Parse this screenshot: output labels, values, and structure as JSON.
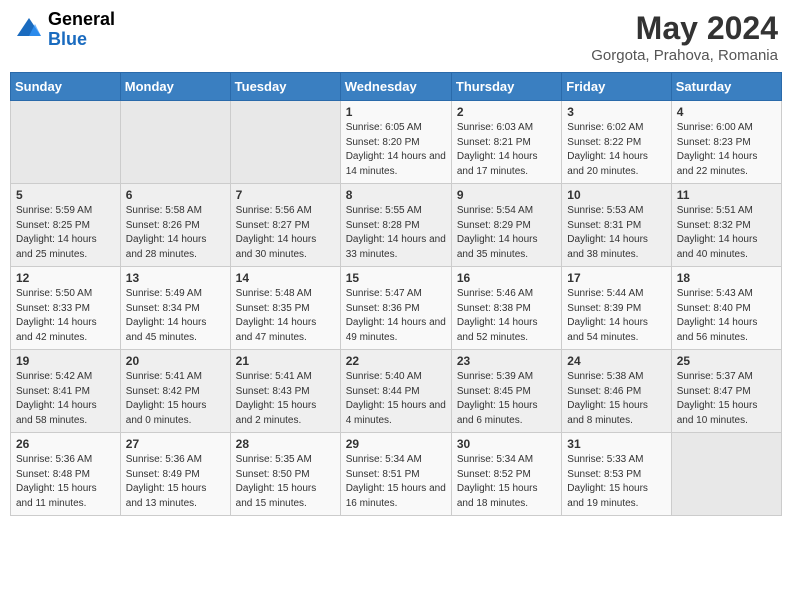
{
  "header": {
    "logo": {
      "general": "General",
      "blue": "Blue"
    },
    "month": "May 2024",
    "location": "Gorgota, Prahova, Romania"
  },
  "days_of_week": [
    "Sunday",
    "Monday",
    "Tuesday",
    "Wednesday",
    "Thursday",
    "Friday",
    "Saturday"
  ],
  "weeks": [
    [
      {
        "day": "",
        "info": ""
      },
      {
        "day": "",
        "info": ""
      },
      {
        "day": "",
        "info": ""
      },
      {
        "day": "1",
        "info": "Sunrise: 6:05 AM\nSunset: 8:20 PM\nDaylight: 14 hours and 14 minutes."
      },
      {
        "day": "2",
        "info": "Sunrise: 6:03 AM\nSunset: 8:21 PM\nDaylight: 14 hours and 17 minutes."
      },
      {
        "day": "3",
        "info": "Sunrise: 6:02 AM\nSunset: 8:22 PM\nDaylight: 14 hours and 20 minutes."
      },
      {
        "day": "4",
        "info": "Sunrise: 6:00 AM\nSunset: 8:23 PM\nDaylight: 14 hours and 22 minutes."
      }
    ],
    [
      {
        "day": "5",
        "info": "Sunrise: 5:59 AM\nSunset: 8:25 PM\nDaylight: 14 hours and 25 minutes."
      },
      {
        "day": "6",
        "info": "Sunrise: 5:58 AM\nSunset: 8:26 PM\nDaylight: 14 hours and 28 minutes."
      },
      {
        "day": "7",
        "info": "Sunrise: 5:56 AM\nSunset: 8:27 PM\nDaylight: 14 hours and 30 minutes."
      },
      {
        "day": "8",
        "info": "Sunrise: 5:55 AM\nSunset: 8:28 PM\nDaylight: 14 hours and 33 minutes."
      },
      {
        "day": "9",
        "info": "Sunrise: 5:54 AM\nSunset: 8:29 PM\nDaylight: 14 hours and 35 minutes."
      },
      {
        "day": "10",
        "info": "Sunrise: 5:53 AM\nSunset: 8:31 PM\nDaylight: 14 hours and 38 minutes."
      },
      {
        "day": "11",
        "info": "Sunrise: 5:51 AM\nSunset: 8:32 PM\nDaylight: 14 hours and 40 minutes."
      }
    ],
    [
      {
        "day": "12",
        "info": "Sunrise: 5:50 AM\nSunset: 8:33 PM\nDaylight: 14 hours and 42 minutes."
      },
      {
        "day": "13",
        "info": "Sunrise: 5:49 AM\nSunset: 8:34 PM\nDaylight: 14 hours and 45 minutes."
      },
      {
        "day": "14",
        "info": "Sunrise: 5:48 AM\nSunset: 8:35 PM\nDaylight: 14 hours and 47 minutes."
      },
      {
        "day": "15",
        "info": "Sunrise: 5:47 AM\nSunset: 8:36 PM\nDaylight: 14 hours and 49 minutes."
      },
      {
        "day": "16",
        "info": "Sunrise: 5:46 AM\nSunset: 8:38 PM\nDaylight: 14 hours and 52 minutes."
      },
      {
        "day": "17",
        "info": "Sunrise: 5:44 AM\nSunset: 8:39 PM\nDaylight: 14 hours and 54 minutes."
      },
      {
        "day": "18",
        "info": "Sunrise: 5:43 AM\nSunset: 8:40 PM\nDaylight: 14 hours and 56 minutes."
      }
    ],
    [
      {
        "day": "19",
        "info": "Sunrise: 5:42 AM\nSunset: 8:41 PM\nDaylight: 14 hours and 58 minutes."
      },
      {
        "day": "20",
        "info": "Sunrise: 5:41 AM\nSunset: 8:42 PM\nDaylight: 15 hours and 0 minutes."
      },
      {
        "day": "21",
        "info": "Sunrise: 5:41 AM\nSunset: 8:43 PM\nDaylight: 15 hours and 2 minutes."
      },
      {
        "day": "22",
        "info": "Sunrise: 5:40 AM\nSunset: 8:44 PM\nDaylight: 15 hours and 4 minutes."
      },
      {
        "day": "23",
        "info": "Sunrise: 5:39 AM\nSunset: 8:45 PM\nDaylight: 15 hours and 6 minutes."
      },
      {
        "day": "24",
        "info": "Sunrise: 5:38 AM\nSunset: 8:46 PM\nDaylight: 15 hours and 8 minutes."
      },
      {
        "day": "25",
        "info": "Sunrise: 5:37 AM\nSunset: 8:47 PM\nDaylight: 15 hours and 10 minutes."
      }
    ],
    [
      {
        "day": "26",
        "info": "Sunrise: 5:36 AM\nSunset: 8:48 PM\nDaylight: 15 hours and 11 minutes."
      },
      {
        "day": "27",
        "info": "Sunrise: 5:36 AM\nSunset: 8:49 PM\nDaylight: 15 hours and 13 minutes."
      },
      {
        "day": "28",
        "info": "Sunrise: 5:35 AM\nSunset: 8:50 PM\nDaylight: 15 hours and 15 minutes."
      },
      {
        "day": "29",
        "info": "Sunrise: 5:34 AM\nSunset: 8:51 PM\nDaylight: 15 hours and 16 minutes."
      },
      {
        "day": "30",
        "info": "Sunrise: 5:34 AM\nSunset: 8:52 PM\nDaylight: 15 hours and 18 minutes."
      },
      {
        "day": "31",
        "info": "Sunrise: 5:33 AM\nSunset: 8:53 PM\nDaylight: 15 hours and 19 minutes."
      },
      {
        "day": "",
        "info": ""
      }
    ]
  ]
}
